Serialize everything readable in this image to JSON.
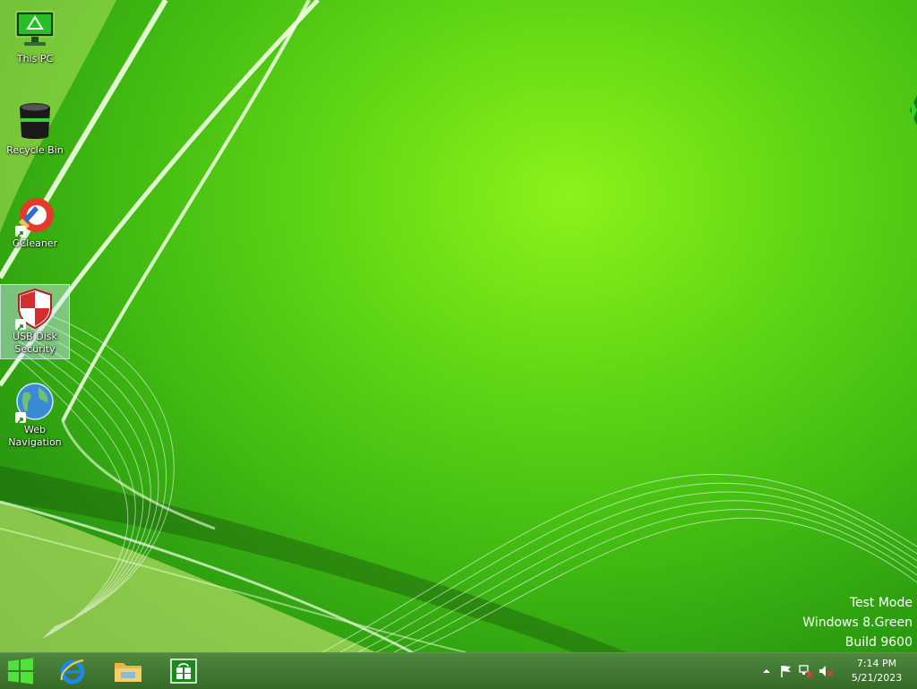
{
  "desktop": {
    "icons": [
      {
        "label": "This PC",
        "icon": "this-pc-icon"
      },
      {
        "label": "Recycle Bin",
        "icon": "recycle-bin-icon"
      },
      {
        "label": "CCleaner",
        "icon": "ccleaner-icon"
      },
      {
        "label": "USB Disk Security",
        "icon": "shield-icon"
      },
      {
        "label": "Web Navigation",
        "icon": "globe-icon"
      }
    ],
    "selected_icon": "USB Disk Security",
    "watermark": {
      "line1": "Test Mode",
      "line2": "Windows 8.Green",
      "line3": "Build 9600"
    }
  },
  "taskbar": {
    "pinned": [
      {
        "name": "start",
        "icon": "windows-logo-icon"
      },
      {
        "name": "internet-explorer",
        "icon": "internet-explorer-icon"
      },
      {
        "name": "file-explorer",
        "icon": "folder-icon"
      },
      {
        "name": "store",
        "icon": "store-icon"
      }
    ],
    "tray": {
      "icons": [
        "chevron-up-icon",
        "action-center-flag-icon",
        "network-error-icon",
        "volume-muted-icon"
      ],
      "time": "7:14 PM",
      "date": "5/21/2023"
    }
  },
  "colors": {
    "wallpaper_primary": "#5fd614",
    "wallpaper_highlight": "#8cf21a",
    "taskbar": "#2d6e16",
    "text": "#ffffff"
  }
}
